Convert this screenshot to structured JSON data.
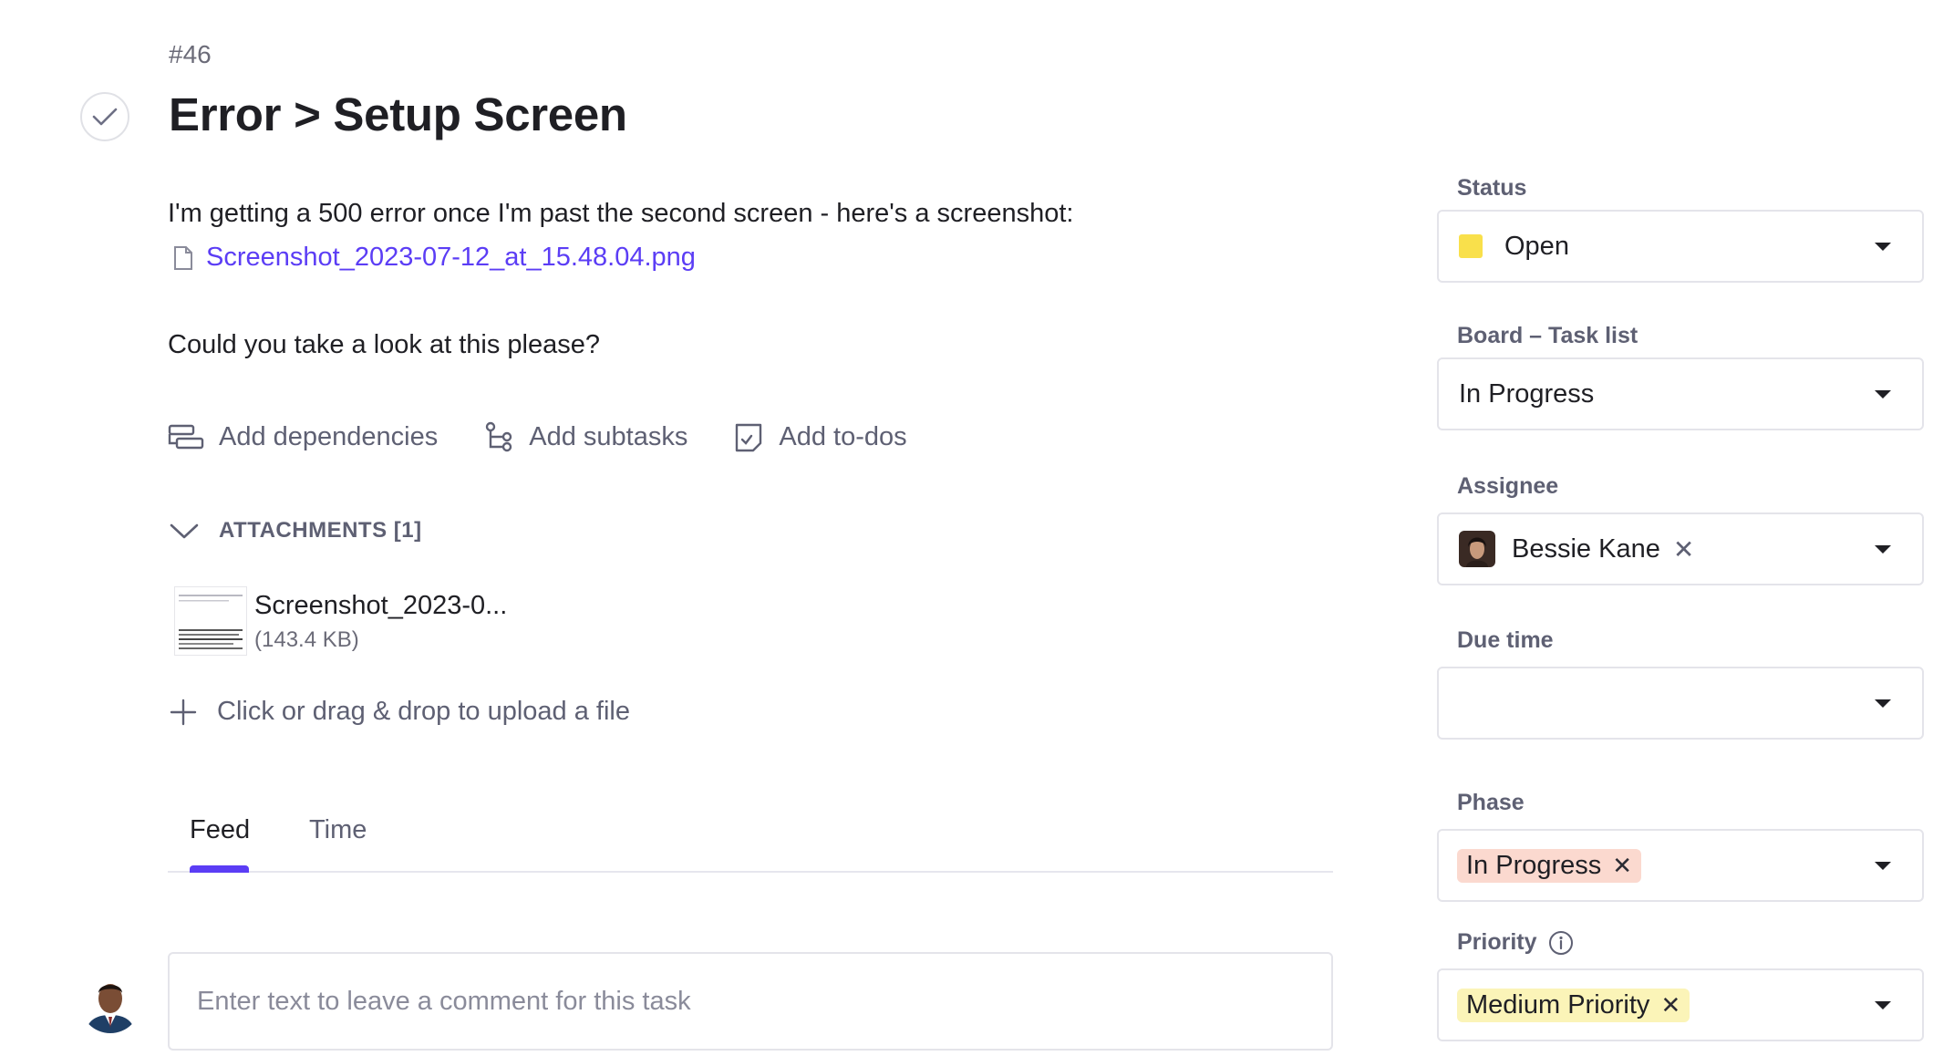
{
  "task": {
    "number": "#46",
    "title": "Error > Setup Screen",
    "description_line1": "I'm getting a 500 error once I'm past the second screen - here's a screenshot:",
    "file_link": "Screenshot_2023-07-12_at_15.48.04.png",
    "description_line2": "Could you take a look at this please?"
  },
  "actions": {
    "dependencies": "Add dependencies",
    "subtasks": "Add subtasks",
    "todos": "Add to-dos"
  },
  "attachments": {
    "header": "ATTACHMENTS [1]",
    "items": [
      {
        "name": "Screenshot_2023-0...",
        "size": "(143.4 KB)"
      }
    ],
    "upload_label": "Click or drag & drop to upload a file"
  },
  "tabs": {
    "feed": "Feed",
    "time": "Time"
  },
  "comment": {
    "placeholder": "Enter text to leave a comment for this task"
  },
  "sidebar": {
    "status": {
      "label": "Status",
      "value": "Open",
      "color": "#f9e04b"
    },
    "board": {
      "label": "Board – Task list",
      "value": "In Progress"
    },
    "assignee": {
      "label": "Assignee",
      "value": "Bessie Kane"
    },
    "due_time": {
      "label": "Due time",
      "value": ""
    },
    "phase": {
      "label": "Phase",
      "value": "In Progress",
      "chip_color": "#fbd9cf"
    },
    "priority": {
      "label": "Priority",
      "value": "Medium Priority",
      "chip_color": "#fbf4b8"
    }
  },
  "colors": {
    "accent": "#5b3df5",
    "muted_text": "#5e6073"
  }
}
